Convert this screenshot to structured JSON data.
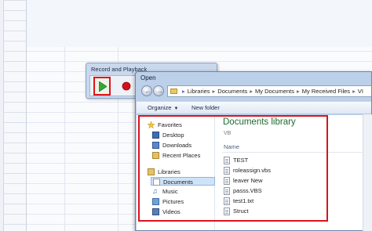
{
  "record_playback": {
    "title": "Record and Playback",
    "play_icon": "play-icon",
    "record_icon": "record-icon",
    "colors": {
      "highlight": "#e0141c",
      "play": "#3aa63a",
      "record": "#d41018"
    }
  },
  "open_dialog": {
    "title": "Open",
    "address": {
      "segments": [
        "Libraries",
        "Documents",
        "My Documents",
        "My Received Files",
        "VI"
      ]
    },
    "toolbar": {
      "organize": "Organize",
      "new_folder": "New folder"
    },
    "nav": {
      "favorites_header": "Favorites",
      "favorites": [
        "Desktop",
        "Downloads",
        "Recent Places"
      ],
      "libraries_header": "Libraries",
      "libraries": [
        "Documents",
        "Music",
        "Pictures",
        "Videos"
      ],
      "selected": "Documents"
    },
    "library": {
      "title": "Documents library",
      "subtitle": "VB",
      "column_name": "Name",
      "files": [
        "TEST",
        "roleassign.vbs",
        "leaver New",
        "passs.VBS",
        "test1.txt",
        "Struct"
      ]
    }
  },
  "colors": {
    "library_title": "#1d6b2e",
    "highlight_border": "#d9141c",
    "selection": "#cfe3f8"
  }
}
